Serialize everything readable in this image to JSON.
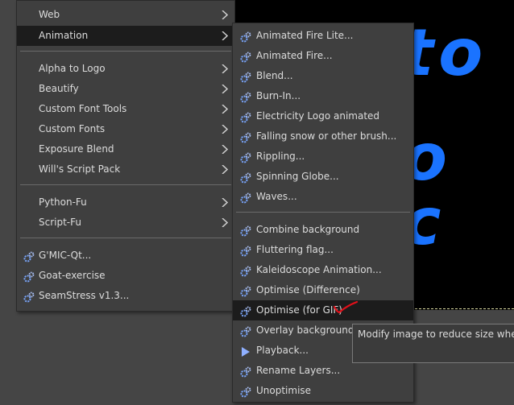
{
  "left_menu": {
    "items": [
      {
        "label": "Web",
        "submenu": true
      },
      {
        "label": "Animation",
        "submenu": true,
        "highlighted": true
      },
      {
        "label": "Alpha to Logo",
        "submenu": true
      },
      {
        "label": "Beautify",
        "submenu": true
      },
      {
        "label": "Custom Font Tools",
        "submenu": true
      },
      {
        "label": "Custom Fonts",
        "submenu": true
      },
      {
        "label": "Exposure Blend",
        "submenu": true
      },
      {
        "label": "Will's Script Pack",
        "submenu": true
      },
      {
        "label": "Python-Fu",
        "submenu": true
      },
      {
        "label": "Script-Fu",
        "submenu": true
      },
      {
        "label": "G'MIC-Qt...",
        "icon": "gears-icon"
      },
      {
        "label": "Goat-exercise",
        "icon": "gears-icon"
      },
      {
        "label": "SeamStress v1.3...",
        "icon": "gears-icon"
      }
    ]
  },
  "right_menu": {
    "items": [
      {
        "label": "Animated Fire Lite...",
        "icon": "gears-icon"
      },
      {
        "label": "Animated Fire...",
        "icon": "gears-icon"
      },
      {
        "label": "Blend...",
        "icon": "gears-icon"
      },
      {
        "label": "Burn-In...",
        "icon": "gears-icon"
      },
      {
        "label": "Electricity Logo animated",
        "icon": "gears-icon"
      },
      {
        "label": "Falling snow or other brush...",
        "icon": "gears-icon"
      },
      {
        "label": "Rippling...",
        "icon": "gears-icon"
      },
      {
        "label": "Spinning Globe...",
        "icon": "gears-icon"
      },
      {
        "label": "Waves...",
        "icon": "gears-icon"
      },
      {
        "label": "Combine background",
        "icon": "gears-icon"
      },
      {
        "label": "Fluttering flag...",
        "icon": "gears-icon"
      },
      {
        "label": "Kaleidoscope Animation...",
        "icon": "gears-icon"
      },
      {
        "label": "Optimise (Difference)",
        "icon": "gears-icon"
      },
      {
        "label": "Optimise (for GIF)",
        "icon": "gears-icon",
        "highlighted": true
      },
      {
        "label": "Overlay background",
        "icon": "gears-icon"
      },
      {
        "label": "Playback...",
        "icon": "play-icon"
      },
      {
        "label": "Rename Layers...",
        "icon": "gears-icon"
      },
      {
        "label": "Unoptimise",
        "icon": "gears-icon"
      }
    ]
  },
  "tooltip": {
    "text": "Modify image to reduce size when"
  },
  "canvas": {
    "logo_line_1": "to",
    "logo_line_2": "o c"
  },
  "colors": {
    "menu_bg": "#3f3f3f",
    "highlight": "#1c1c1c",
    "logo": "#1a73ff",
    "annotation": "#e0101a"
  }
}
